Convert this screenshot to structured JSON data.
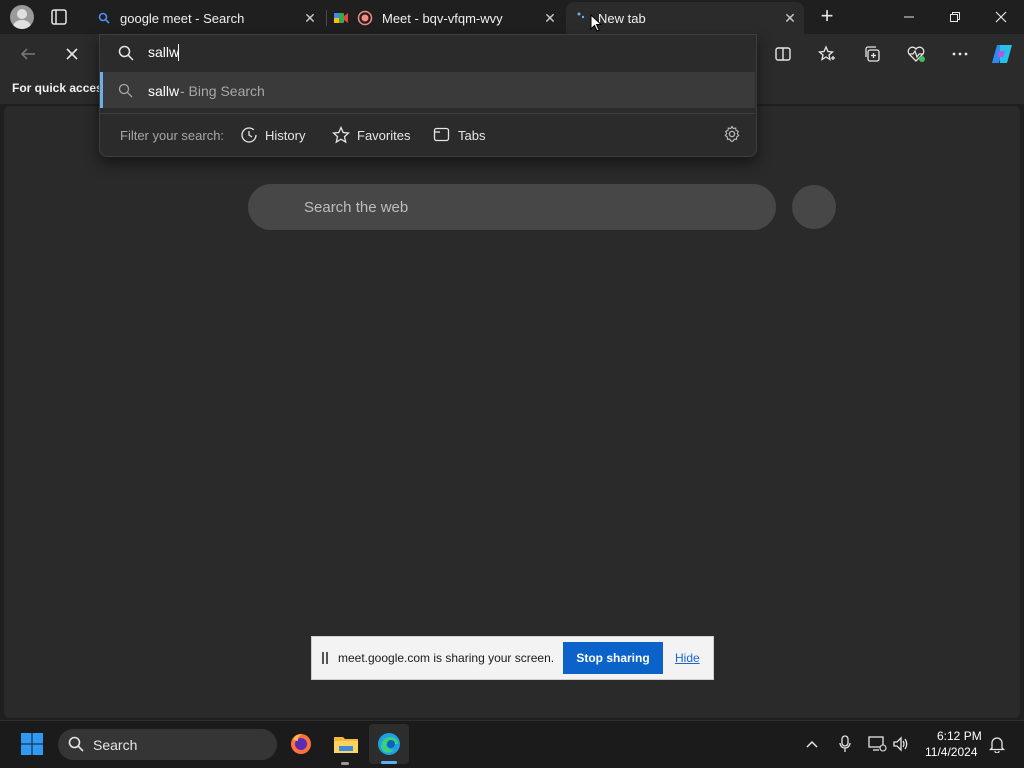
{
  "browser": {
    "tabs": [
      {
        "label": "google meet - Search",
        "icon": "bing-search-icon"
      },
      {
        "label": "Meet - bqv-vfqm-wvy",
        "icon": "google-meet-icon"
      },
      {
        "label": "New tab",
        "icon": "loading-icon"
      }
    ],
    "close_glyph": "✕",
    "new_tab_glyph": "+"
  },
  "address_bar": {
    "value": "sallw",
    "suggestion_query": "sallw",
    "suggestion_suffix": " - Bing Search",
    "filter_label": "Filter your search:",
    "filters": [
      "History",
      "Favorites",
      "Tabs"
    ]
  },
  "favorites_bar": {
    "text": "For quick access"
  },
  "new_tab_page": {
    "search_placeholder": "Search the web"
  },
  "sharing_banner": {
    "message": "meet.google.com is sharing your screen.",
    "stop_label": "Stop sharing",
    "hide_label": "Hide"
  },
  "taskbar": {
    "search_label": "Search",
    "time": "6:12 PM",
    "date": "11/4/2024"
  },
  "colors": {
    "accent_blue": "#0b62c9",
    "suggestion_highlight": "#6aaeea"
  }
}
